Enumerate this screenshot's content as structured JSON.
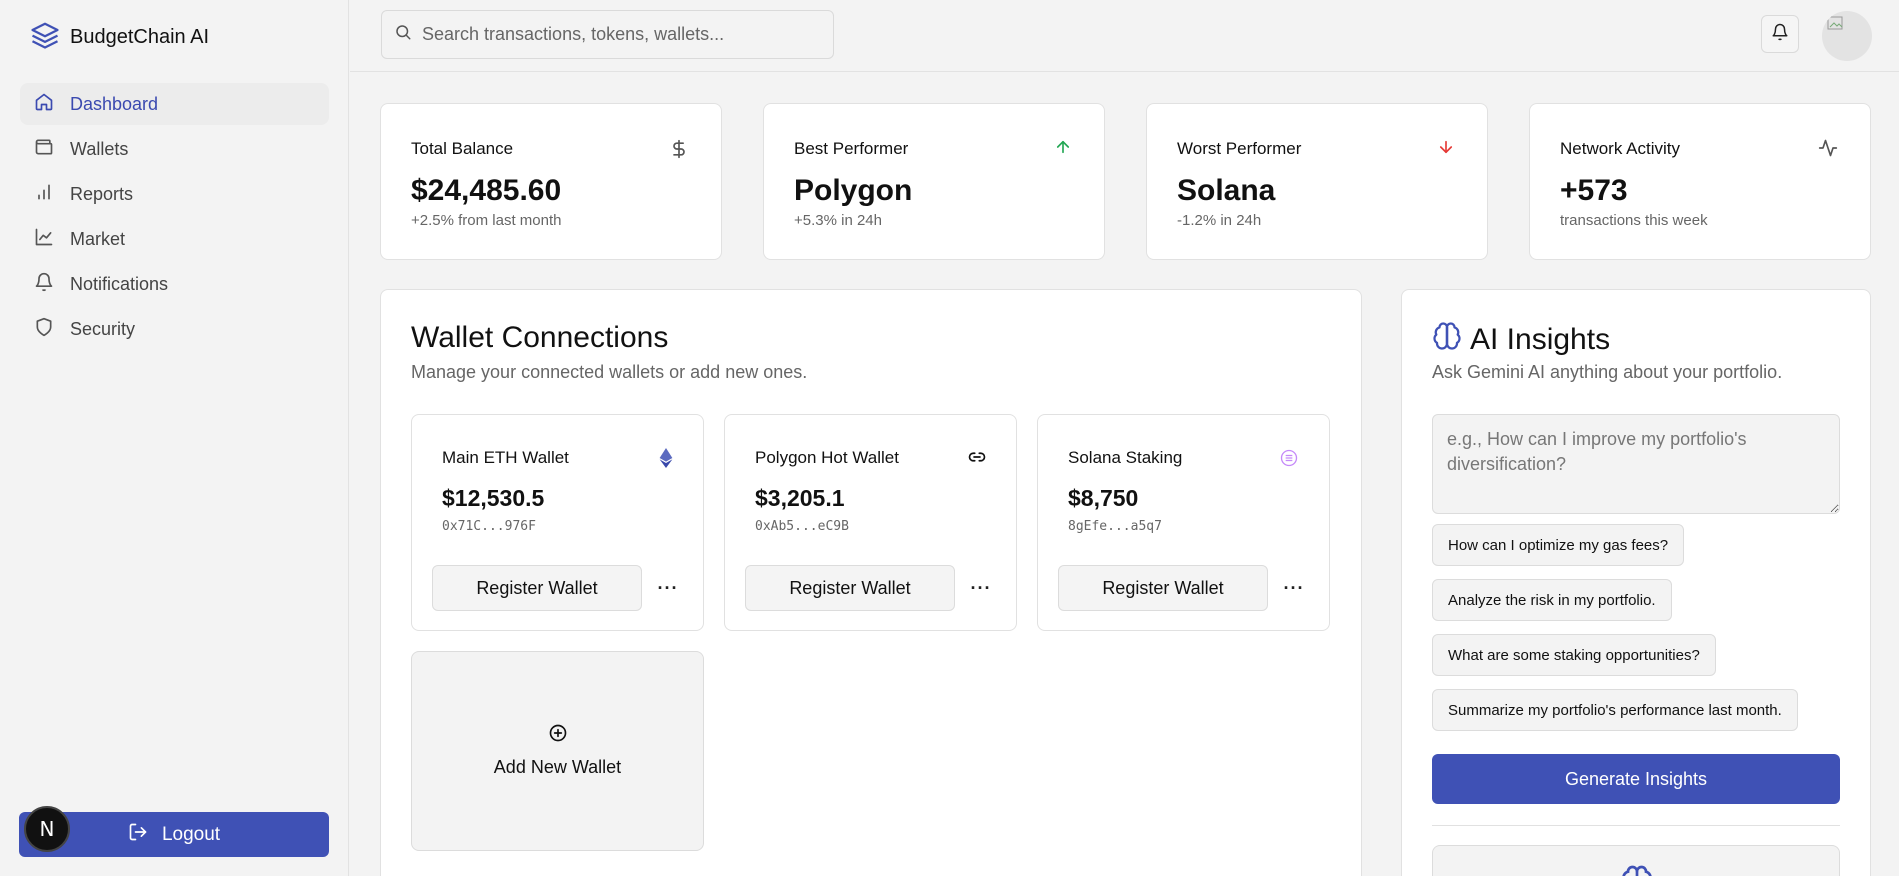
{
  "app": {
    "name": "BudgetChain AI"
  },
  "sidebar": {
    "items": [
      {
        "label": "Dashboard",
        "icon": "home-icon",
        "active": true
      },
      {
        "label": "Wallets",
        "icon": "wallet-icon",
        "active": false
      },
      {
        "label": "Reports",
        "icon": "bar-chart-icon",
        "active": false
      },
      {
        "label": "Market",
        "icon": "line-chart-icon",
        "active": false
      },
      {
        "label": "Notifications",
        "icon": "bell-icon",
        "active": false
      },
      {
        "label": "Security",
        "icon": "shield-icon",
        "active": false
      }
    ],
    "logout_label": "Logout",
    "badge_letter": "N"
  },
  "header": {
    "search_placeholder": "Search transactions, tokens, wallets..."
  },
  "stats": [
    {
      "title": "Total Balance",
      "value": "$24,485.60",
      "sub": "+2.5% from last month",
      "icon": "dollar-icon"
    },
    {
      "title": "Best Performer",
      "value": "Polygon",
      "sub": "+5.3% in 24h",
      "icon": "arrow-up-icon"
    },
    {
      "title": "Worst Performer",
      "value": "Solana",
      "sub": "-1.2% in 24h",
      "icon": "arrow-down-icon"
    },
    {
      "title": "Network Activity",
      "value": "+573",
      "sub": "transactions this week",
      "icon": "activity-icon"
    }
  ],
  "wallets": {
    "title": "Wallet Connections",
    "subtitle": "Manage your connected wallets or add new ones.",
    "items": [
      {
        "name": "Main ETH Wallet",
        "value": "$12,530.5",
        "address": "0x71C...976F",
        "icon": "ethereum-icon",
        "button": "Register Wallet"
      },
      {
        "name": "Polygon Hot Wallet",
        "value": "$3,205.1",
        "address": "0xAb5...eC9B",
        "icon": "link-icon",
        "button": "Register Wallet"
      },
      {
        "name": "Solana Staking",
        "value": "$8,750",
        "address": "8gEfe...a5q7",
        "icon": "solana-icon",
        "button": "Register Wallet"
      }
    ],
    "more_label": "···",
    "add_label": "Add New Wallet"
  },
  "ai": {
    "title": "AI Insights",
    "subtitle": "Ask Gemini AI anything about your portfolio.",
    "placeholder": "e.g., How can I improve my portfolio's diversification?",
    "suggestions": [
      "How can I optimize my gas fees?",
      "Analyze the risk in my portfolio.",
      "What are some staking opportunities?",
      "Summarize my portfolio's performance last month."
    ],
    "button": "Generate Insights"
  },
  "colors": {
    "accent": "#3f51b5",
    "up": "#22a653",
    "down": "#e53935",
    "eth": "#5c6bc0",
    "sol": "#c58af9"
  }
}
